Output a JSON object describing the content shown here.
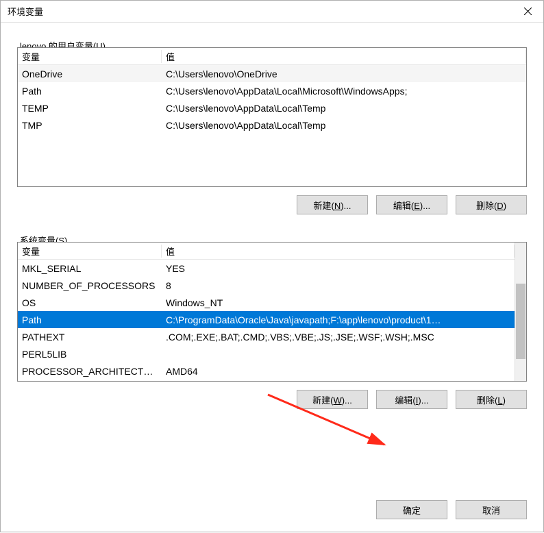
{
  "window": {
    "title": "环境变量"
  },
  "user_vars": {
    "label_prefix": "lenovo 的用户变量(",
    "label_key": "U",
    "label_suffix": ")",
    "columns": {
      "name": "变量",
      "value": "值"
    },
    "rows": [
      {
        "name": "OneDrive",
        "value": "C:\\Users\\lenovo\\OneDrive"
      },
      {
        "name": "Path",
        "value": "C:\\Users\\lenovo\\AppData\\Local\\Microsoft\\WindowsApps;"
      },
      {
        "name": "TEMP",
        "value": "C:\\Users\\lenovo\\AppData\\Local\\Temp"
      },
      {
        "name": "TMP",
        "value": "C:\\Users\\lenovo\\AppData\\Local\\Temp"
      }
    ],
    "buttons": {
      "new_prefix": "新建(",
      "new_key": "N",
      "new_suffix": ")...",
      "edit_prefix": "编辑(",
      "edit_key": "E",
      "edit_suffix": ")...",
      "delete_prefix": "删除(",
      "delete_key": "D",
      "delete_suffix": ")"
    }
  },
  "system_vars": {
    "label_prefix": "系统变量(",
    "label_key": "S",
    "label_suffix": ")",
    "columns": {
      "name": "变量",
      "value": "值"
    },
    "rows": [
      {
        "name": "MKL_SERIAL",
        "value": "YES"
      },
      {
        "name": "NUMBER_OF_PROCESSORS",
        "value": "8"
      },
      {
        "name": "OS",
        "value": "Windows_NT"
      },
      {
        "name": "Path",
        "value": "C:\\ProgramData\\Oracle\\Java\\javapath;F:\\app\\lenovo\\product\\1…",
        "selected": true
      },
      {
        "name": "PATHEXT",
        "value": ".COM;.EXE;.BAT;.CMD;.VBS;.VBE;.JS;.JSE;.WSF;.WSH;.MSC"
      },
      {
        "name": "PERL5LIB",
        "value": ""
      },
      {
        "name": "PROCESSOR_ARCHITECTURE",
        "value": "AMD64"
      }
    ],
    "buttons": {
      "new_prefix": "新建(",
      "new_key": "W",
      "new_suffix": ")...",
      "edit_prefix": "编辑(",
      "edit_key": "I",
      "edit_suffix": ")...",
      "delete_prefix": "删除(",
      "delete_key": "L",
      "delete_suffix": ")"
    }
  },
  "footer": {
    "ok": "确定",
    "cancel": "取消"
  }
}
